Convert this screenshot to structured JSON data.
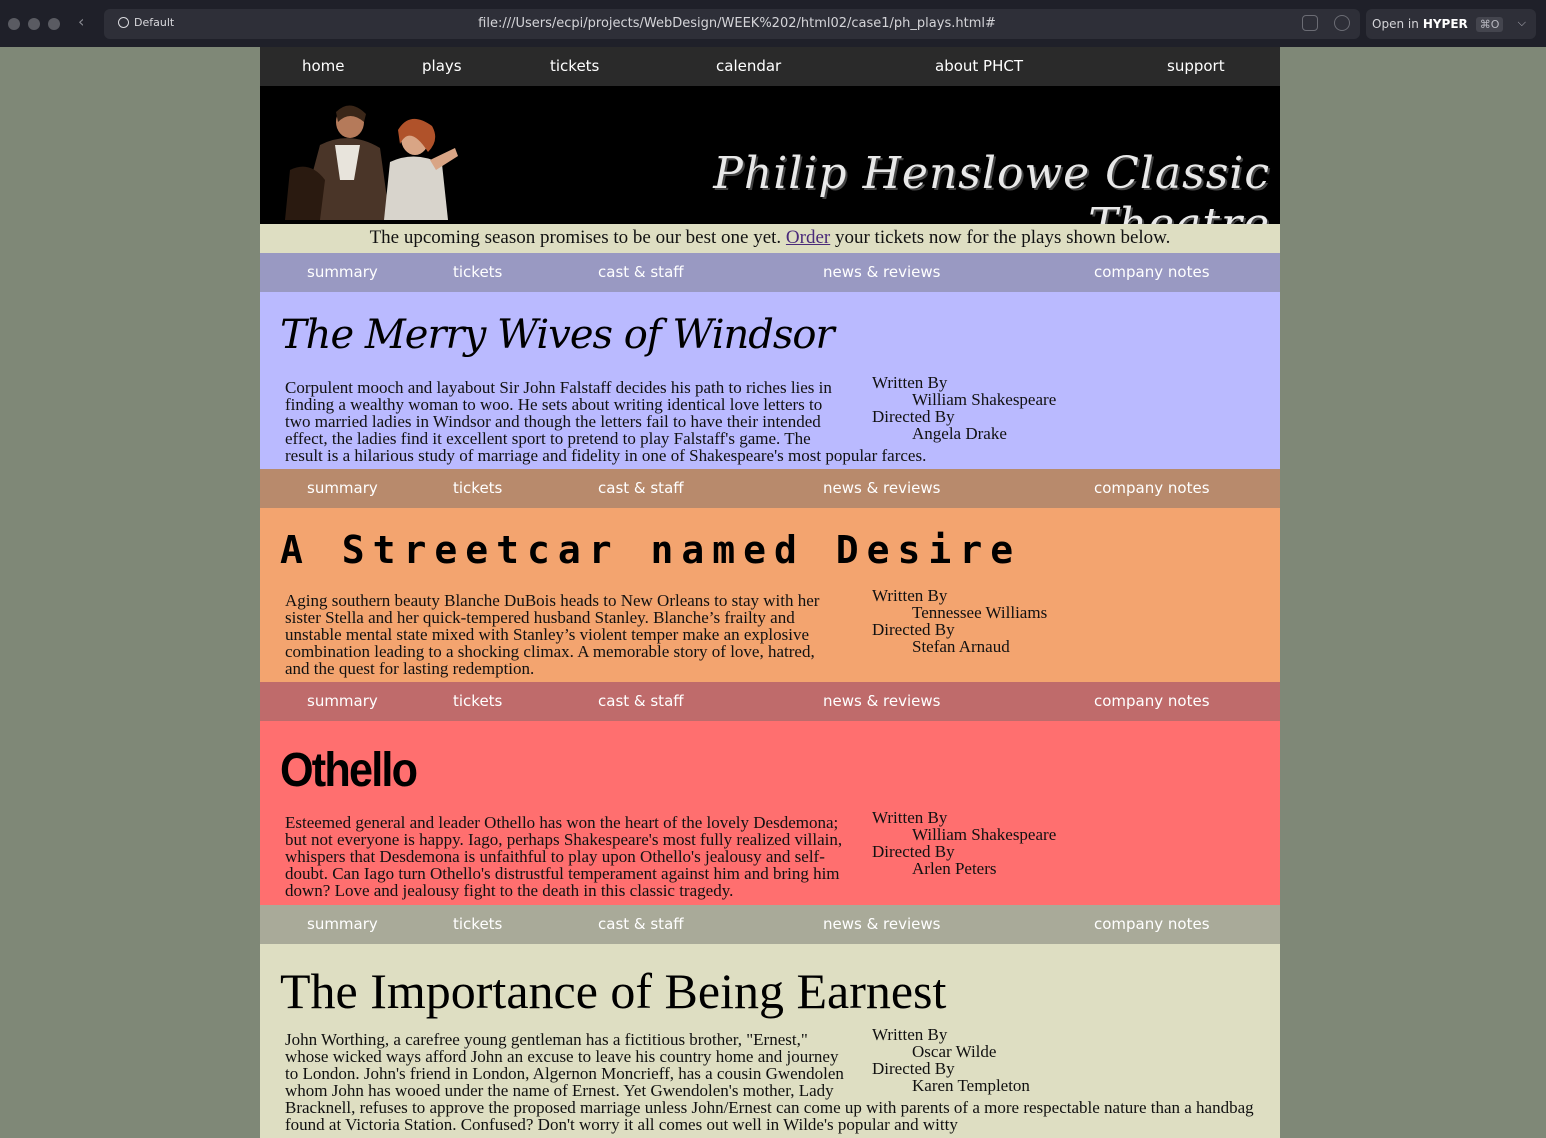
{
  "browser": {
    "profile": "Default",
    "url": "file:///Users/ecpi/projects/WebDesign/WEEK%202/html02/case1/ph_plays.html#",
    "open_in_prefix": "Open in",
    "open_in_app": "HYPER",
    "shortcut": "⌘O"
  },
  "site": {
    "nav": [
      "home",
      "plays",
      "tickets",
      "calendar",
      "about PHCT",
      "support"
    ],
    "banner_title": "Philip Henslowe Classic Theatre",
    "intro_before": "The upcoming season promises to be our best one yet.",
    "intro_link": "Order",
    "intro_after": "your tickets now for the plays shown below.",
    "subnav": [
      "summary",
      "tickets",
      "cast & staff",
      "news & reviews",
      "company notes"
    ]
  },
  "labels": {
    "written_by": "Written By",
    "directed_by": "Directed By"
  },
  "plays": [
    {
      "title": "The Merry Wives of Windsor",
      "summary": "Corpulent mooch and layabout Sir John Falstaff decides his path to riches lies in finding a wealthy woman to woo. He sets about writing identical love letters to two married ladies in Windsor and though the letters fail to have their intended effect, the ladies find it excellent sport to pretend to play Falstaff's game. The result is a hilarious study of marriage and fidelity in one of Shakespeare's most popular farces.",
      "writer": "William Shakespeare",
      "director": "Angela Drake"
    },
    {
      "title": "A Streetcar named Desire",
      "summary": "Aging southern beauty Blanche DuBois heads to New Orleans to stay with her sister Stella and her quick-tempered husband Stanley. Blanche’s frailty and unstable mental state mixed with Stanley’s violent temper make an explosive combination leading to a shocking climax. A memorable story of love, hatred, and the quest for lasting redemption.",
      "writer": "Tennessee Williams",
      "director": "Stefan Arnaud"
    },
    {
      "title": "Othello",
      "summary": "Esteemed general and leader Othello has won the heart of the lovely Desdemona; but not everyone is happy. Iago, perhaps Shakespeare's most fully realized villain, whispers that Desdemona is unfaithful to play upon Othello's jealousy and self-doubt. Can Iago turn Othello's distrustful temperament against him and bring him down? Love and jealousy fight to the death in this classic tragedy.",
      "writer": "William Shakespeare",
      "director": "Arlen Peters"
    },
    {
      "title": "The Importance of Being Earnest",
      "summary": "John Worthing, a carefree young gentleman has a fictitious brother, \"Ernest,\" whose wicked ways afford John an excuse to leave his country home and journey to London. John's friend in London, Algernon Moncrieff, has a cousin Gwendolen whom John has wooed under the name of Ernest. Yet Gwendolen's mother, Lady Bracknell, refuses to approve the proposed marriage unless John/Ernest can come up with parents of a more respectable nature than a handbag found at Victoria Station. Confused? Don't worry it all comes out well in Wilde's popular and witty",
      "writer": "Oscar Wilde",
      "director": "Karen Templeton"
    }
  ]
}
